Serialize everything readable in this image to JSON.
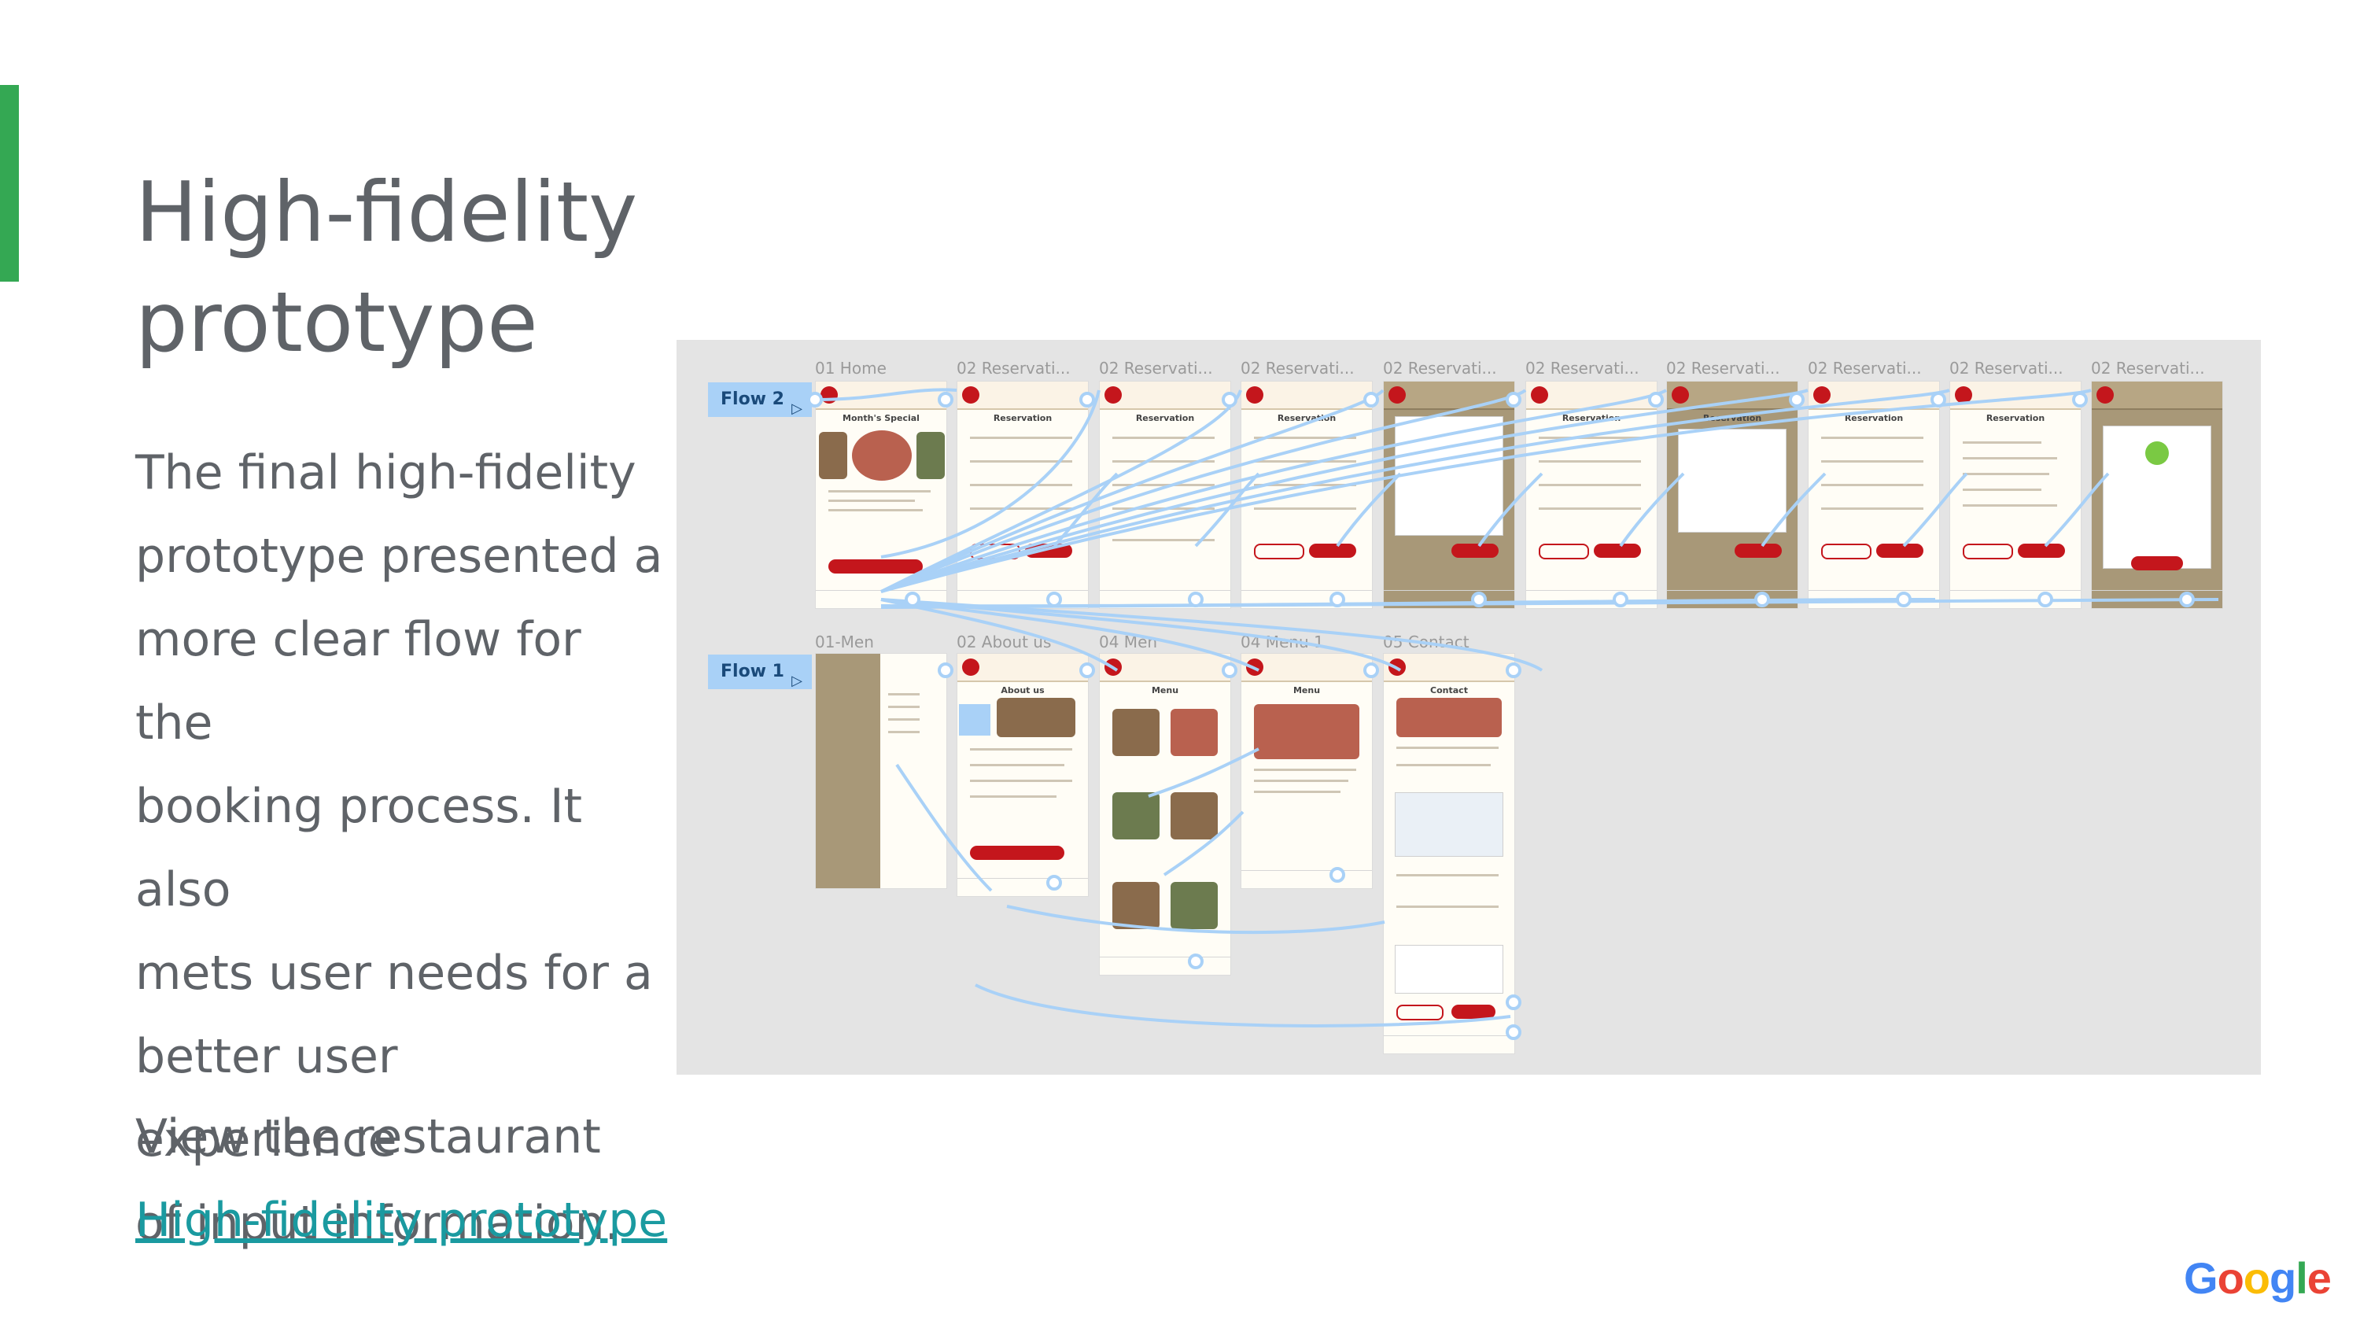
{
  "slide": {
    "title_line1": "High-fidelity",
    "title_line2": "prototype",
    "body_lines": [
      "The final high-fidelity",
      "prototype presented a",
      "more clear flow for the",
      "booking process. It also",
      "mets user needs for a",
      "better user experience",
      "of input information."
    ],
    "view_text": "View the restaurant",
    "link_text": "High-fidelity prototype"
  },
  "prototype": {
    "flows": [
      {
        "label": "Flow 2",
        "play_icon": "play-icon"
      },
      {
        "label": "Flow 1",
        "play_icon": "play-icon"
      }
    ],
    "row1_frames": [
      "01 Home",
      "02 Reservati...",
      "02 Reservati...",
      "02 Reservati...",
      "02 Reservati...",
      "02 Reservati...",
      "02 Reservati...",
      "02 Reservati...",
      "02 Reservati...",
      "02 Reservati..."
    ],
    "row2_frames": [
      "01-Men",
      "02 About us",
      "04 Men",
      "04 Menu 1",
      "05 Contact"
    ],
    "connector_color": "#a9d1f7"
  },
  "branding": {
    "logo_text": "Google",
    "colors": [
      "#4285f4",
      "#ea4335",
      "#fbbc05",
      "#4285f4",
      "#34a853",
      "#ea4335"
    ]
  },
  "colors": {
    "accent": "#34a853",
    "text": "#5f6368",
    "link": "#1a9aa0",
    "brand_red": "#c4161c"
  }
}
